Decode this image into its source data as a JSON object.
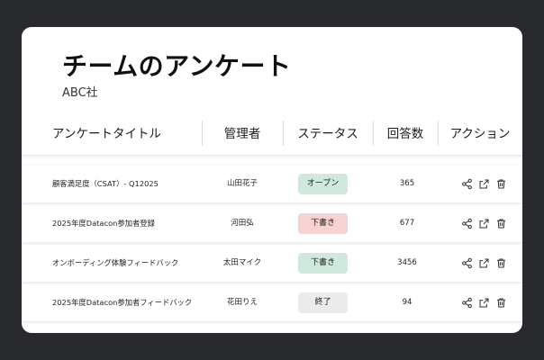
{
  "header": {
    "title": "チームのアンケート",
    "company": "ABC社"
  },
  "table": {
    "columns": [
      "アンケートタイトル",
      "管理者",
      "ステータス",
      "回答数",
      "アクション"
    ],
    "rows": [
      {
        "title": "顧客満足度（CSAT）- Q12025",
        "owner": "山田花子",
        "status": "オープン",
        "status_color": "#cfe9dd",
        "count": "365",
        "actions": [
          "share-icon",
          "export-icon",
          "trash-icon"
        ]
      },
      {
        "title": "2025年度Datacon参加者登録",
        "owner": "河田弘",
        "status": "下書き",
        "status_color": "#f7d2d3",
        "count": "677",
        "actions": [
          "share-icon",
          "export-icon",
          "trash-icon"
        ]
      },
      {
        "title": "オンボーディング体験フィードバック",
        "owner": "太田マイク",
        "status": "下書き",
        "status_color": "#cfe9dd",
        "count": "3456",
        "actions": [
          "share-icon",
          "export-icon",
          "trash-icon"
        ]
      },
      {
        "title": "2025年度Datacon参加者フィードバック",
        "owner": "花田りえ",
        "status": "終了",
        "status_color": "#ebebeb",
        "count": "94",
        "actions": [
          "share-icon",
          "export-icon",
          "trash-icon"
        ]
      }
    ]
  },
  "colors": {
    "background": "#282a2e",
    "card": "#ffffff"
  }
}
